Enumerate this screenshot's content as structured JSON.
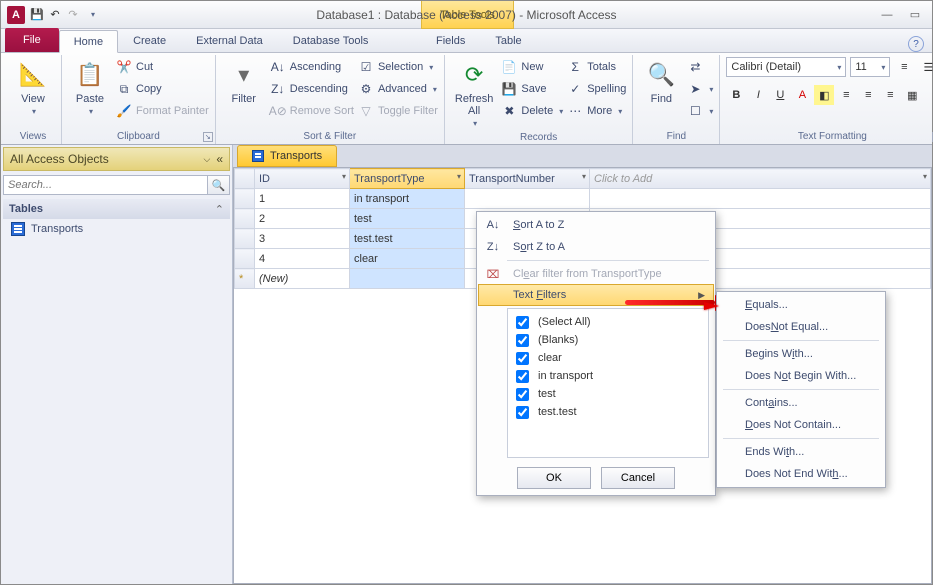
{
  "title_bar": {
    "app_letter": "A",
    "table_tools": "Table Tools",
    "title": "Database1 : Database (Access 2007)  -  Microsoft Access"
  },
  "tabs": {
    "file": "File",
    "home": "Home",
    "create": "Create",
    "external_data": "External Data",
    "database_tools": "Database Tools",
    "fields": "Fields",
    "table": "Table"
  },
  "ribbon": {
    "views": {
      "view": "View",
      "group": "Views"
    },
    "clipboard": {
      "paste": "Paste",
      "cut": "Cut",
      "copy": "Copy",
      "format_painter": "Format Painter",
      "group": "Clipboard"
    },
    "sortfilter": {
      "filter": "Filter",
      "ascending": "Ascending",
      "descending": "Descending",
      "remove_sort": "Remove Sort",
      "selection": "Selection",
      "advanced": "Advanced",
      "toggle_filter": "Toggle Filter",
      "group": "Sort & Filter"
    },
    "records": {
      "refresh_all": "Refresh\nAll",
      "new": "New",
      "save": "Save",
      "delete": "Delete",
      "totals": "Totals",
      "spelling": "Spelling",
      "more": "More",
      "group": "Records"
    },
    "find": {
      "find": "Find",
      "group": "Find"
    },
    "text_fmt": {
      "font": "Calibri (Detail)",
      "size": "11",
      "group": "Text Formatting"
    }
  },
  "nav": {
    "header": "All Access Objects",
    "search_placeholder": "Search...",
    "tables_label": "Tables",
    "table_item": "Transports"
  },
  "doc_tab": "Transports",
  "columns": {
    "id": "ID",
    "type": "TransportType",
    "number": "TransportNumber",
    "click_add": "Click to Add"
  },
  "rows": [
    {
      "id": "1",
      "type": "in transport"
    },
    {
      "id": "2",
      "type": "test"
    },
    {
      "id": "3",
      "type": "test.test"
    },
    {
      "id": "4",
      "type": "clear"
    }
  ],
  "new_row": "(New)",
  "context_menu": {
    "sort_az": "Sort A to Z",
    "sort_za": "Sort Z to A",
    "clear_filter": "Clear filter from TransportType",
    "text_filters": "Text Filters",
    "options": [
      "(Select All)",
      "(Blanks)",
      "clear",
      "in transport",
      "test",
      "test.test"
    ],
    "ok": "OK",
    "cancel": "Cancel"
  },
  "submenu": {
    "equals": "Equals...",
    "not_equal": "Does Not Equal...",
    "begins": "Begins With...",
    "not_begin": "Does Not Begin With...",
    "contains": "Contains...",
    "not_contain": "Does Not Contain...",
    "ends": "Ends With...",
    "not_end": "Does Not End With..."
  }
}
